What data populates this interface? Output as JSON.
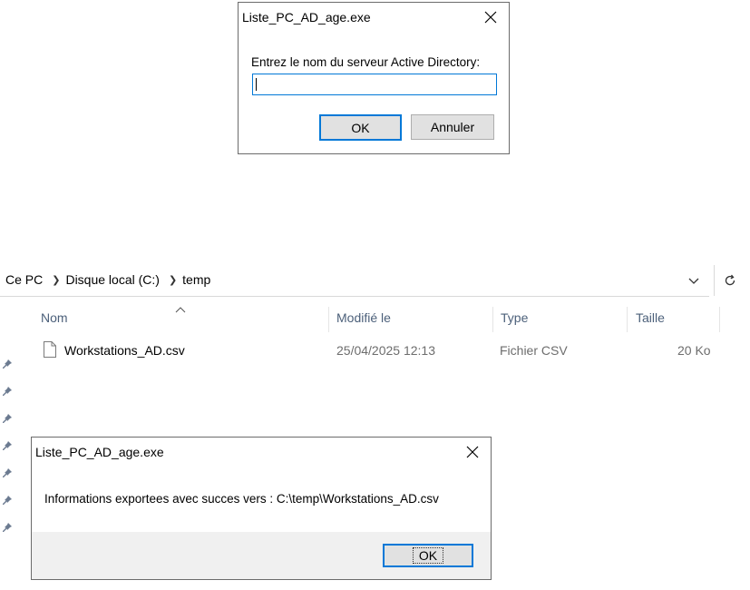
{
  "dialog_input": {
    "title": "Liste_PC_AD_age.exe",
    "prompt": "Entrez le nom du serveur Active Directory:",
    "input_value": "",
    "ok_label": "OK",
    "cancel_label": "Annuler"
  },
  "explorer": {
    "breadcrumb": [
      "Ce PC",
      "Disque local (C:)",
      "temp"
    ],
    "columns": {
      "name": "Nom",
      "modified": "Modifié le",
      "type": "Type",
      "size": "Taille"
    },
    "files": [
      {
        "name": "Workstations_AD.csv",
        "modified": "25/04/2025 12:13",
        "type": "Fichier CSV",
        "size": "20 Ko"
      }
    ]
  },
  "dialog_message": {
    "title": "Liste_PC_AD_age.exe",
    "message": "Informations exportees avec succes vers : C:\\temp\\Workstations_AD.csv",
    "ok_label": "OK"
  },
  "colors": {
    "accent": "#0078d7",
    "header_text": "#4c607a",
    "button_bg": "#e1e1e1",
    "footer_bg": "#f0f0f0"
  }
}
